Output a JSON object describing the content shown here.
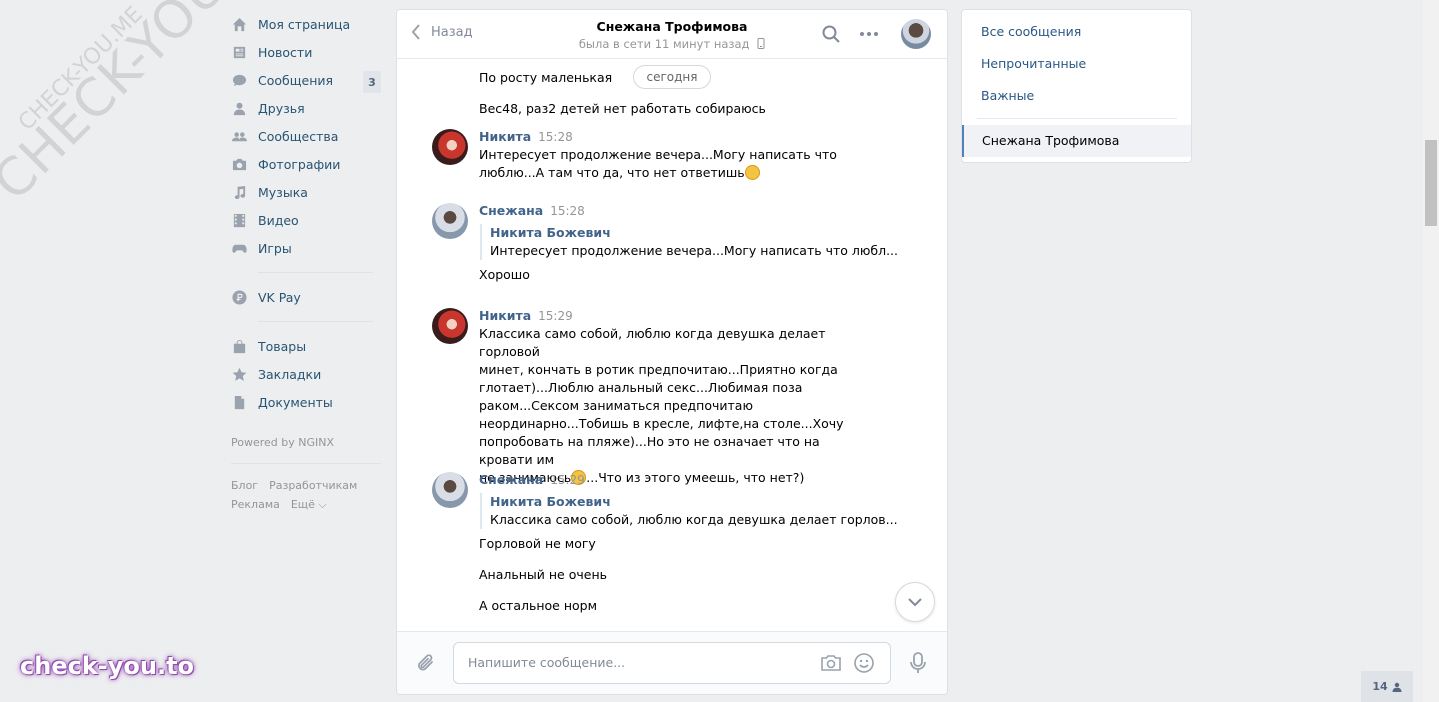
{
  "nav": {
    "items": [
      {
        "label": "Моя страница",
        "icon": "home-icon"
      },
      {
        "label": "Новости",
        "icon": "news-icon"
      },
      {
        "label": "Сообщения",
        "icon": "messages-icon",
        "badge": "3"
      },
      {
        "label": "Друзья",
        "icon": "friends-icon"
      },
      {
        "label": "Сообщества",
        "icon": "groups-icon"
      },
      {
        "label": "Фотографии",
        "icon": "camera-icon"
      },
      {
        "label": "Музыка",
        "icon": "music-icon"
      },
      {
        "label": "Видео",
        "icon": "video-icon"
      },
      {
        "label": "Игры",
        "icon": "gamepad-icon"
      }
    ],
    "vkpay": {
      "label": "VK Pay",
      "icon": "ruble-icon"
    },
    "extra": [
      {
        "label": "Товары",
        "icon": "bag-icon"
      },
      {
        "label": "Закладки",
        "icon": "star-icon"
      },
      {
        "label": "Документы",
        "icon": "document-icon"
      }
    ],
    "powered": "Powered by NGINX",
    "footer": {
      "blog": "Блог",
      "dev": "Разработчикам",
      "ads": "Реклама",
      "more": "Ещё ⌵"
    }
  },
  "watermark": {
    "main": "CHECK-YOU.ME",
    "small": "CHECK-YOU.ME",
    "bottom": "check-you.to"
  },
  "chat": {
    "back": "Назад",
    "peer_name": "Снежана Трофимова",
    "peer_status": "была в сети 11 минут назад",
    "date_pill": "сегодня",
    "top_lines": [
      "По росту маленькая",
      "Вес48, раз2 детей нет работать собираюсь"
    ],
    "messages": [
      {
        "author": "Никита",
        "time": "15:28",
        "lines": [
          "Интересует продолжение вечера...Могу написать что",
          "люблю...А там что да, что нет ответишь"
        ]
      },
      {
        "author": "Снежана",
        "time": "15:28",
        "fwd_author": "Никита Божевич",
        "fwd_text": "Интересует продолжение вечера...Могу написать что любл...",
        "lines": [
          "Хорошо"
        ]
      },
      {
        "author": "Никита",
        "time": "15:29",
        "lines": [
          "Классика само собой, люблю когда девушка делает горловой",
          "минет, кончать в ротик предпочитаю...Приятно когда",
          "глотает)...Люблю анальный секс...Любимая поза",
          "раком...Сексом заниматься предпочитаю",
          "неординарно...Тобишь в кресле, лифте,на столе...Хочу",
          "попробовать на пляже)...Но это не означает что на кровати им",
          "не занимаюсь",
          "...Что из этого умеешь, что нет?)"
        ]
      },
      {
        "author": "Снежана",
        "time": "15:29",
        "fwd_author": "Никита Божевич",
        "fwd_text": "Классика само собой, люблю когда девушка делает горлов...",
        "lines": [
          "Горловой не могу",
          "Анальный не очень",
          "А остальное норм"
        ]
      }
    ],
    "composer_placeholder": "Напишите сообщение..."
  },
  "right": {
    "all": "Все сообщения",
    "unread": "Непрочитанные",
    "important": "Важные",
    "active": "Снежана Трофимова"
  },
  "online_count": "14"
}
